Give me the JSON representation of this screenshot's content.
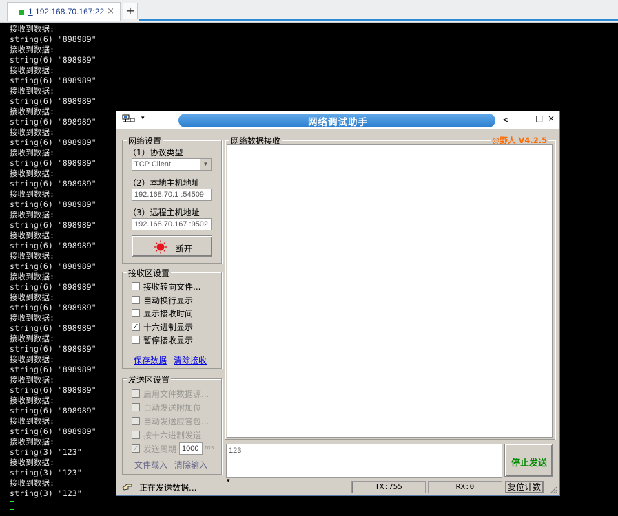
{
  "tab": {
    "index": "1",
    "title": "192.168.70.167:22",
    "close": "×",
    "add": "+"
  },
  "terminal": {
    "lines": [
      "接收到数据:",
      "string(6) \"898989\"",
      "接收到数据:",
      "string(6) \"898989\"",
      "接收到数据:",
      "string(6) \"898989\"",
      "接收到数据:",
      "string(6) \"898989\"",
      "接收到数据:",
      "string(6) \"898989\"",
      "接收到数据:",
      "string(6) \"898989\"",
      "接收到数据:",
      "string(6) \"898989\"",
      "接收到数据:",
      "string(6) \"898989\"",
      "接收到数据:",
      "string(6) \"898989\"",
      "接收到数据:",
      "string(6) \"898989\"",
      "接收到数据:",
      "string(6) \"898989\"",
      "接收到数据:",
      "string(6) \"898989\"",
      "接收到数据:",
      "string(6) \"898989\"",
      "接收到数据:",
      "string(6) \"898989\"",
      "接收到数据:",
      "string(6) \"898989\"",
      "接收到数据:",
      "string(6) \"898989\"",
      "接收到数据:",
      "string(6) \"898989\"",
      "接收到数据:",
      "string(6) \"898989\"",
      "接收到数据:",
      "string(6) \"898989\"",
      "接收到数据:",
      "string(6) \"898989\"",
      "接收到数据:",
      "string(3) \"123\"",
      "接收到数据:",
      "string(3) \"123\"",
      "接收到数据:",
      "string(3) \"123\""
    ]
  },
  "app": {
    "title": "网络调试助手",
    "menu_arrow": "▾",
    "btn_pin": "⊲",
    "btn_min": "_",
    "btn_max": "□",
    "btn_close": "×",
    "network": {
      "group_title": "网络设置",
      "protocol_label": "（1）协议类型",
      "protocol_value": "TCP Client",
      "local_label": "（2）本地主机地址",
      "local_value": "192.168.70.1 :54509",
      "remote_label": "（3）远程主机地址",
      "remote_value": "192.168.70.167 :9502",
      "connect_button": "断开"
    },
    "receive": {
      "group_title": "接收区设置",
      "options": [
        {
          "label": "接收转向文件...",
          "checked": false
        },
        {
          "label": "自动换行显示",
          "checked": false
        },
        {
          "label": "显示接收时间",
          "checked": false
        },
        {
          "label": "十六进制显示",
          "checked": true
        },
        {
          "label": "暂停接收显示",
          "checked": false
        }
      ],
      "save_link": "保存数据",
      "clear_link": "清除接收"
    },
    "send": {
      "group_title": "发送区设置",
      "options": [
        {
          "label": "启用文件数据源...",
          "checked": false
        },
        {
          "label": "自动发送附加位",
          "checked": false
        },
        {
          "label": "自动发送应答包...",
          "checked": false
        },
        {
          "label": "按十六进制发送",
          "checked": false
        },
        {
          "label": "发送周期",
          "checked": true
        }
      ],
      "period_value": "1000",
      "period_unit": "ms",
      "load_file_link": "文件载入",
      "clear_input_link": "清除输入"
    },
    "data_recv_title": "网络数据接收",
    "version_badge": "@野人 V4.2.5",
    "send_text": "123",
    "stop_send_button": "停止发送",
    "status": {
      "text": "正在发送数据...",
      "dropdown": "▾",
      "tx": "TX:755",
      "rx": "RX:0",
      "reset_button": "复位计数"
    }
  },
  "colors": {
    "version_badge": "#ff6a00",
    "stop_send": "#008a00",
    "connect_indicator": "#e8131b",
    "tab_line": "#2d8bd5"
  }
}
